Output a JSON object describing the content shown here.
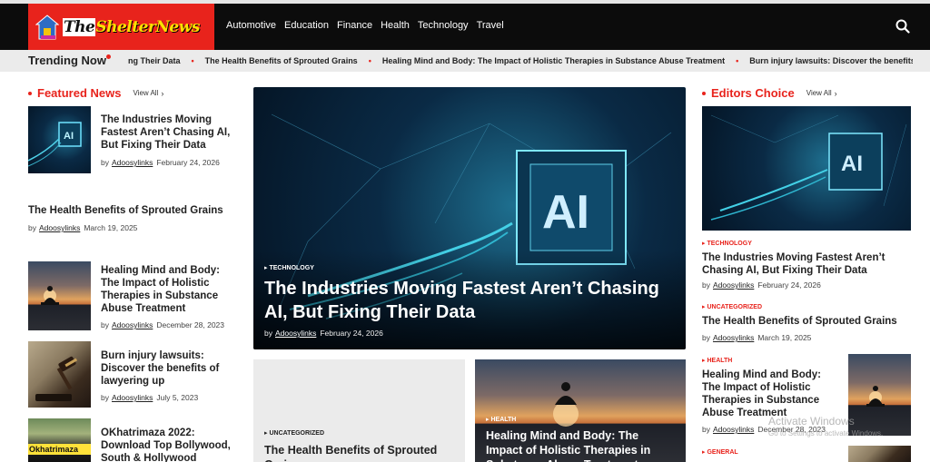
{
  "header": {
    "logo_text_a": "The",
    "logo_text_b": "Shelter",
    "logo_text_c": "News",
    "nav": [
      "Automotive",
      "Education",
      "Finance",
      "Health",
      "Technology",
      "Travel"
    ]
  },
  "trending": {
    "label": "Trending Now",
    "items": [
      "ng Their Data",
      "The Health Benefits of Sprouted Grains",
      "Healing Mind and Body: The Impact of Holistic Therapies in Substance Abuse Treatment",
      "Burn injury lawsuits: Discover the benefits of lawye"
    ]
  },
  "featured": {
    "title": "Featured News",
    "view_all": "View All",
    "posts": [
      {
        "title": "The Industries Moving Fastest Aren’t Chasing AI, But Fixing Their Data",
        "by": "by",
        "author": "Adoosylinks",
        "date": "February 24, 2026"
      },
      {
        "title": "The Health Benefits of Sprouted Grains",
        "by": "by",
        "author": "Adoosylinks",
        "date": "March 19, 2025"
      },
      {
        "title": "Healing Mind and Body: The Impact of Holistic Therapies in Substance Abuse Treatment",
        "by": "by",
        "author": "Adoosylinks",
        "date": "December 28, 2023"
      },
      {
        "title": "Burn injury lawsuits: Discover the benefits of lawyering up",
        "by": "by",
        "author": "Adoosylinks",
        "date": "July 5, 2023"
      },
      {
        "title": "OKhatrimaza 2022: Download Top Bollywood, South & Hollywood",
        "thumb_text": "Okhatrimaza"
      }
    ]
  },
  "hero": {
    "category": "TECHNOLOGY",
    "title": "The Industries Moving Fastest Aren’t Chasing AI, But Fixing Their Data",
    "by": "by",
    "author": "Adoosylinks",
    "date": "February 24, 2026",
    "chip_text": "AI"
  },
  "cards": [
    {
      "category": "UNCATEGORIZED",
      "title": "The Health Benefits of Sprouted Grains"
    },
    {
      "category": "HEALTH",
      "title": "Healing Mind and Body: The Impact of Holistic Therapies in Substance Abuse Treatment"
    }
  ],
  "editors": {
    "title": "Editors Choice",
    "view_all": "View All",
    "posts": [
      {
        "category": "TECHNOLOGY",
        "title": "The Industries Moving Fastest Aren’t Chasing AI, But Fixing Their Data",
        "by": "by",
        "author": "Adoosylinks",
        "date": "February 24, 2026",
        "chip_text": "AI"
      },
      {
        "category": "UNCATEGORIZED",
        "title": "The Health Benefits of Sprouted Grains",
        "by": "by",
        "author": "Adoosylinks",
        "date": "March 19, 2025"
      },
      {
        "category": "HEALTH",
        "title": "Healing Mind and Body: The Impact of Holistic Therapies in Substance Abuse Treatment",
        "by": "by",
        "author": "Adoosylinks",
        "date": "December 28, 2023"
      },
      {
        "category": "GENERAL"
      }
    ]
  },
  "watermark": {
    "line1": "Activate Windows",
    "line2": "Go to Settings to activate Windows."
  },
  "colors": {
    "accent": "#e8231c",
    "header_bg": "#0c0c0c",
    "trending_bg": "#ebebeb"
  }
}
